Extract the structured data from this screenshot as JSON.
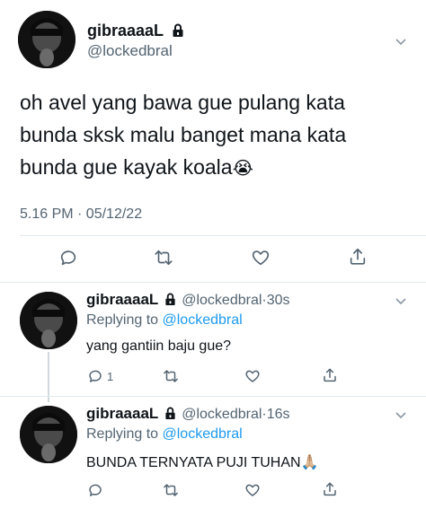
{
  "tweet": {
    "display_name": "gibraaaaL",
    "handle": "@lockedbral",
    "text_line1": "oh avel yang bawa gue pulang kata",
    "text_line2": "bunda sksk malu banget mana kata",
    "text_line3": "bunda gue kayak koala",
    "emoji": "😭",
    "timestamp": "5.16 PM · 05/12/22"
  },
  "replies": [
    {
      "display_name": "gibraaaaL",
      "handle": "@lockedbral",
      "time": "30s",
      "replying_prefix": "Replying to",
      "replying_to": "@lockedbral",
      "text": "yang gantiin baju gue?",
      "reply_count": "1"
    },
    {
      "display_name": "gibraaaaL",
      "handle": "@lockedbral",
      "time": "16s",
      "replying_prefix": "Replying to",
      "replying_to": "@lockedbral",
      "text": "BUNDA TERNYATA PUJI TUHAN",
      "emoji": "🙏🏼"
    }
  ],
  "separator": "·",
  "colors": {
    "accent": "#1d9bf0",
    "secondary_text": "#536471",
    "divider": "#e1e8ed"
  },
  "icons": [
    "lock-icon",
    "chevron-down-icon",
    "reply-icon",
    "retweet-icon",
    "like-icon",
    "share-icon"
  ]
}
